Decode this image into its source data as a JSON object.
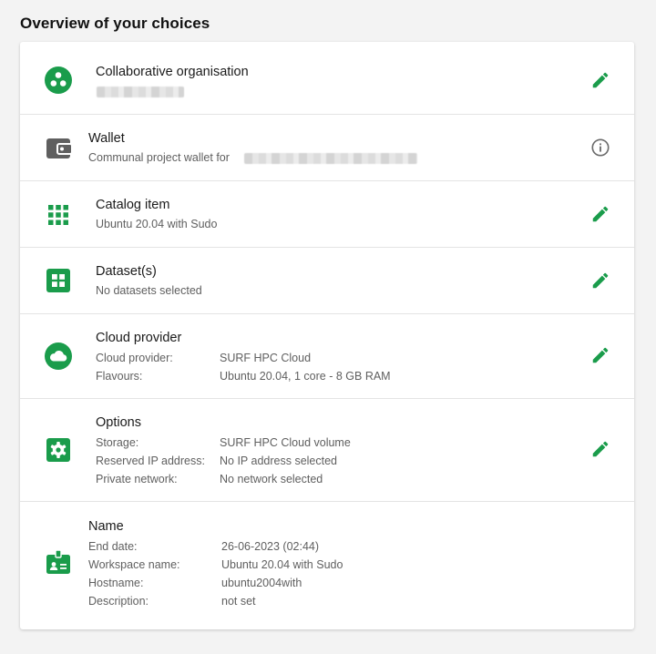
{
  "page": {
    "title": "Overview of your choices"
  },
  "colors": {
    "accent": "#1a9c4b",
    "info": "#6b6b6b",
    "wallet": "#5f5f5f"
  },
  "organisation": {
    "title": "Collaborative organisation",
    "icon": "organisation-icon"
  },
  "wallet": {
    "title": "Wallet",
    "subtitle": "Communal project wallet for",
    "icon": "wallet-icon"
  },
  "catalog": {
    "title": "Catalog item",
    "subtitle": "Ubuntu 20.04 with Sudo",
    "icon": "apps-grid-icon"
  },
  "datasets": {
    "title": "Dataset(s)",
    "subtitle": "No datasets selected",
    "icon": "dataset-icon"
  },
  "cloud": {
    "title": "Cloud provider",
    "icon": "cloud-icon",
    "rows": [
      {
        "label": "Cloud provider:",
        "value": "SURF HPC Cloud"
      },
      {
        "label": "Flavours:",
        "value": "Ubuntu 20.04, 1 core - 8 GB RAM"
      }
    ]
  },
  "options": {
    "title": "Options",
    "icon": "settings-gear-icon",
    "rows": [
      {
        "label": "Storage:",
        "value": "SURF HPC Cloud volume"
      },
      {
        "label": "Reserved IP address:",
        "value": "No IP address selected"
      },
      {
        "label": "Private network:",
        "value": "No network selected"
      }
    ]
  },
  "name": {
    "title": "Name",
    "icon": "badge-icon",
    "rows": [
      {
        "label": "End date:",
        "value": "26-06-2023 (02:44)"
      },
      {
        "label": "Workspace name:",
        "value": "Ubuntu 20.04 with Sudo"
      },
      {
        "label": "Hostname:",
        "value": "ubuntu2004with"
      },
      {
        "label": "Description:",
        "value": "not set"
      }
    ]
  }
}
